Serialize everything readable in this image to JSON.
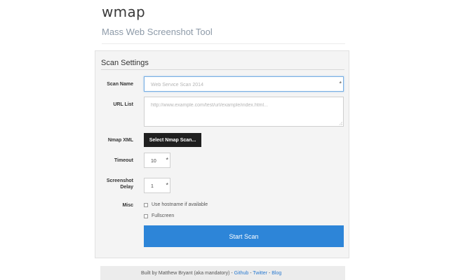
{
  "header": {
    "brand": "wmap",
    "subtitle": "Mass Web Screenshot Tool"
  },
  "form": {
    "title": "Scan Settings",
    "scan_name": {
      "label": "Scan Name",
      "placeholder": "Web Service Scan 2014",
      "required_mark": "*"
    },
    "url_list": {
      "label": "URL List",
      "placeholder": "http://www.example.com/test/url/example/index.html..."
    },
    "nmap_xml": {
      "label": "Nmap XML",
      "button": "Select Nmap Scan..."
    },
    "timeout": {
      "label": "Timeout",
      "value": "10",
      "required_mark": "*"
    },
    "screenshot_delay": {
      "label_line1": "Screenshot",
      "label_line2": "Delay",
      "value": "1",
      "required_mark": "*"
    },
    "misc": {
      "label": "Misc",
      "options": [
        {
          "label": "Use hostname if available",
          "checked": false
        },
        {
          "label": "Fullscreen",
          "checked": false
        }
      ]
    },
    "submit": "Start Scan"
  },
  "footer": {
    "built_by": "Built by Matthew Bryant (aka mandatory) - ",
    "github": "Github",
    "sep1": " - ",
    "twitter": "Twitter",
    "sep2": " - ",
    "blog": "Blog"
  },
  "colors": {
    "accent": "#2d85d8",
    "dark_button": "#1f1f1f",
    "panel_bg": "#f4f4f4",
    "link": "#2a7ad0"
  }
}
